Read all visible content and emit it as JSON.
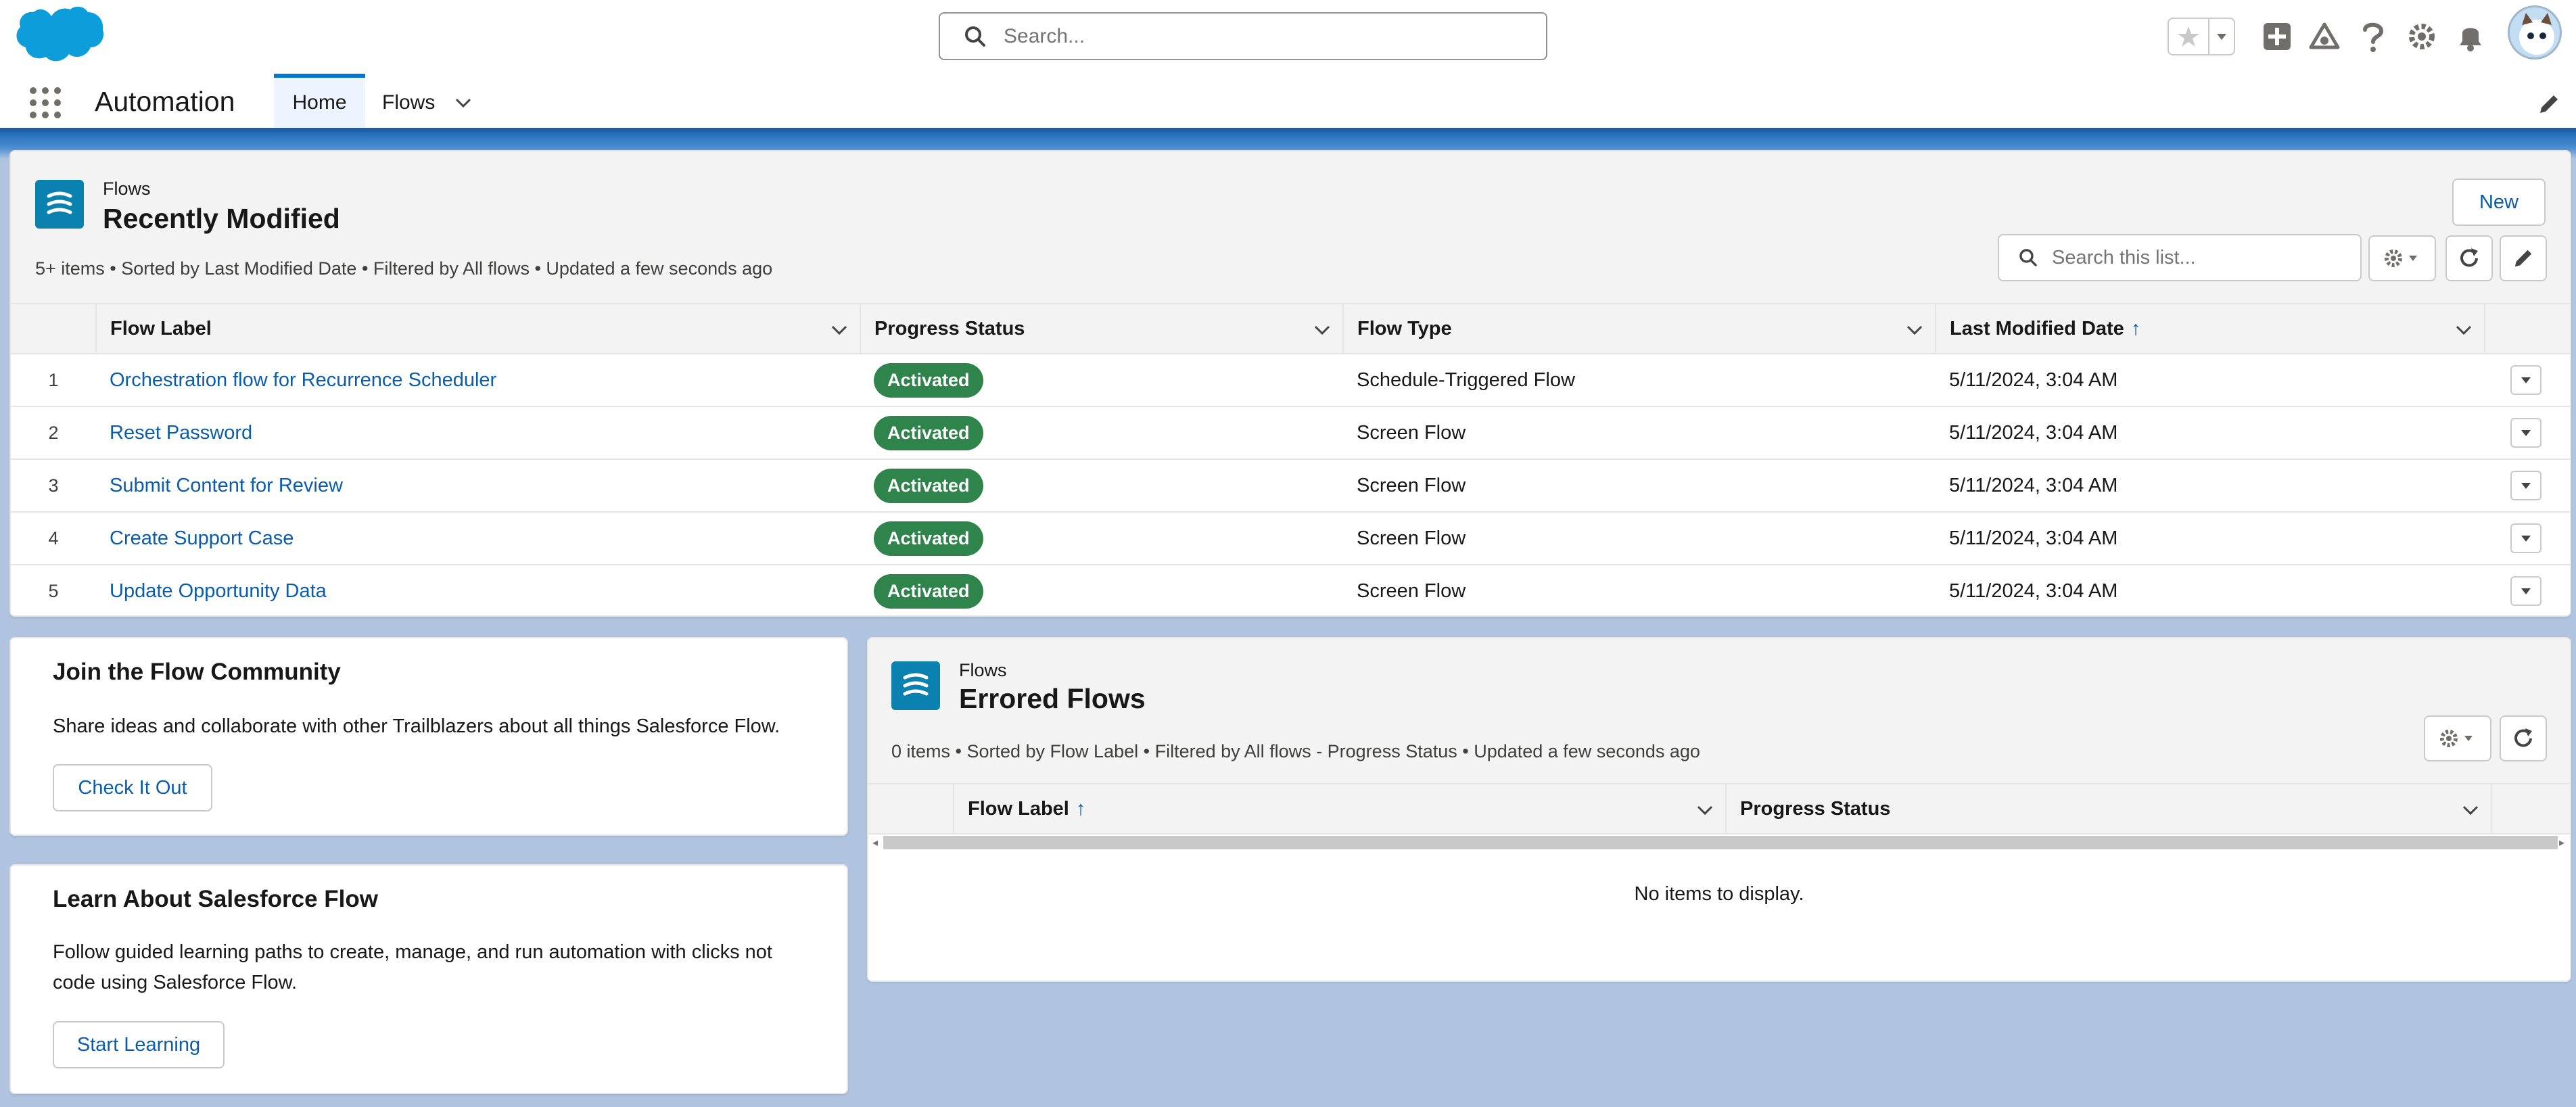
{
  "global_header": {
    "search_placeholder": "Search...",
    "icons": [
      "star-icon",
      "chevron-down-icon",
      "add-icon",
      "trailhead-icon",
      "help-icon",
      "setup-gear-icon",
      "notification-bell-icon",
      "avatar"
    ]
  },
  "app_nav": {
    "app_name": "Automation",
    "tabs": [
      {
        "label": "Home",
        "active": true
      },
      {
        "label": "Flows",
        "active": false
      }
    ]
  },
  "recently_modified": {
    "object_label": "Flows",
    "title": "Recently Modified",
    "meta": "5+ items • Sorted by Last Modified Date • Filtered by All flows • Updated a few seconds ago",
    "new_button": "New",
    "search_placeholder": "Search this list...",
    "columns": [
      "Flow Label",
      "Progress Status",
      "Flow Type",
      "Last Modified Date"
    ],
    "sort_indicator": "↑",
    "rows": [
      {
        "num": "1",
        "label": "Orchestration flow for Recurrence Scheduler",
        "status": "Activated",
        "type": "Schedule-Triggered Flow",
        "modified": "5/11/2024, 3:04 AM"
      },
      {
        "num": "2",
        "label": "Reset Password",
        "status": "Activated",
        "type": "Screen Flow",
        "modified": "5/11/2024, 3:04 AM"
      },
      {
        "num": "3",
        "label": "Submit Content for Review",
        "status": "Activated",
        "type": "Screen Flow",
        "modified": "5/11/2024, 3:04 AM"
      },
      {
        "num": "4",
        "label": "Create Support Case",
        "status": "Activated",
        "type": "Screen Flow",
        "modified": "5/11/2024, 3:04 AM"
      },
      {
        "num": "5",
        "label": "Update Opportunity Data",
        "status": "Activated",
        "type": "Screen Flow",
        "modified": "5/11/2024, 3:04 AM"
      }
    ],
    "colors": {
      "badge": "#2e844a",
      "link": "#0b5cab"
    }
  },
  "community_card": {
    "title": "Join the Flow Community",
    "body": "Share ideas and collaborate with other Trailblazers about all things Salesforce Flow.",
    "button": "Check It Out"
  },
  "learn_card": {
    "title": "Learn About Salesforce Flow",
    "body_line1": "Follow guided learning paths to create, manage, and run automation with clicks not",
    "body_line2": "code using Salesforce Flow.",
    "button": "Start Learning"
  },
  "errored_flows": {
    "object_label": "Flows",
    "title": "Errored Flows",
    "meta": "0 items • Sorted by Flow Label • Filtered by All flows - Progress Status • Updated a few seconds ago",
    "columns": [
      "Flow Label",
      "Progress Status"
    ],
    "sort_indicator": "↑",
    "empty_message": "No items to display."
  }
}
